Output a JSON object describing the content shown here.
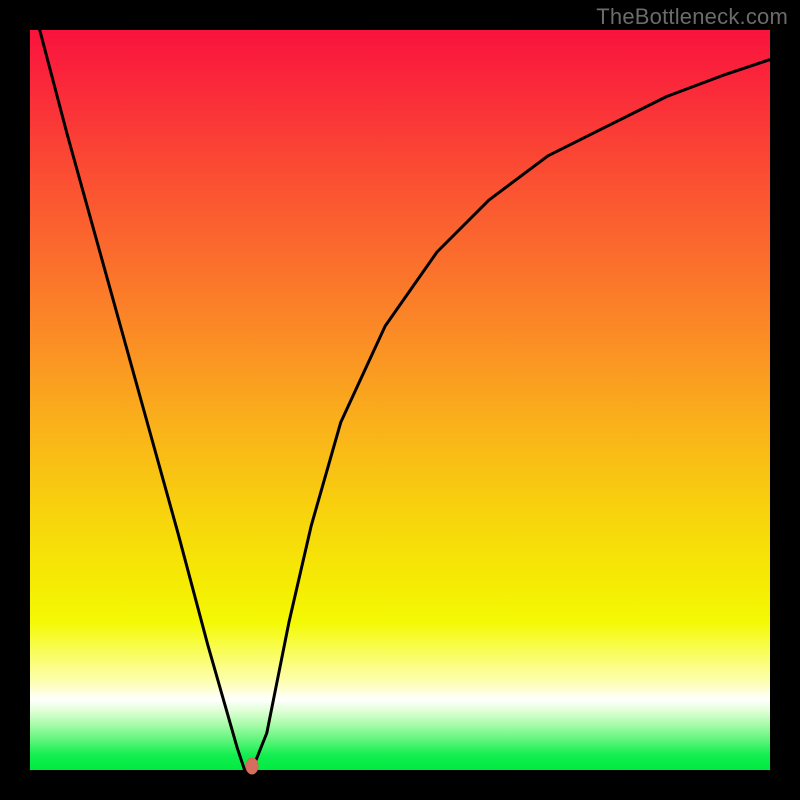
{
  "watermark": "TheBottleneck.com",
  "chart_data": {
    "type": "line",
    "title": "",
    "xlabel": "",
    "ylabel": "",
    "xlim": [
      0,
      100
    ],
    "ylim": [
      0,
      100
    ],
    "legend": false,
    "grid": false,
    "background": "rainbow-gradient",
    "series": [
      {
        "name": "bottleneck-curve",
        "x": [
          0,
          5,
          10,
          15,
          20,
          24,
          26,
          28,
          29,
          30,
          32,
          33,
          35,
          38,
          42,
          48,
          55,
          62,
          70,
          78,
          86,
          94,
          100
        ],
        "y": [
          105,
          86,
          68,
          50,
          32,
          17,
          10,
          3,
          0,
          0,
          5,
          10,
          20,
          33,
          47,
          60,
          70,
          77,
          83,
          87,
          91,
          94,
          96
        ]
      }
    ],
    "marker": {
      "x_pct": 30.0,
      "y_pct": 0.5,
      "color": "#d56e5e"
    },
    "annotations": []
  },
  "colors": {
    "top": "#f9133d",
    "mid": "#f7d50c",
    "bottom": "#00eb40",
    "curve": "#000000",
    "marker": "#d56e5e",
    "frame": "#000000"
  }
}
